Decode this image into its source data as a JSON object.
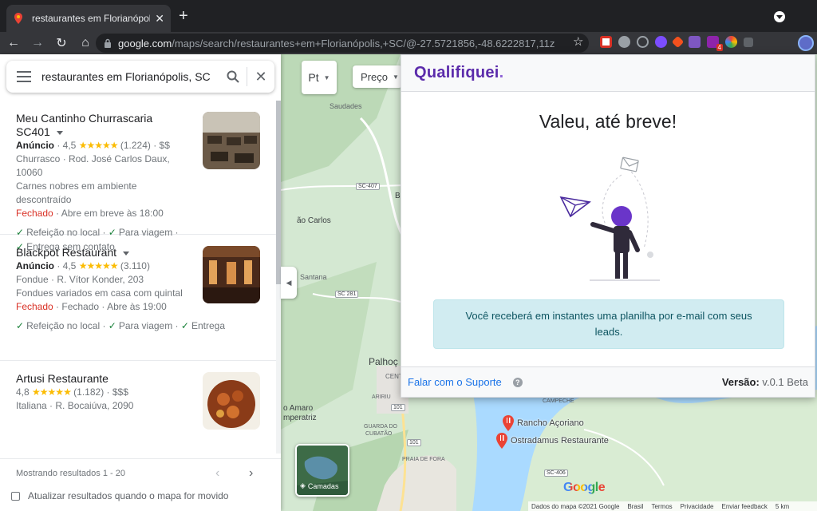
{
  "browser": {
    "tab_title": "restaurantes em Florianópolis, SC",
    "url_host": "google.com",
    "url_path": "/maps/search/restaurantes+em+Florianópolis,+SC/@-27.5721856,-48.6222817,11z",
    "ext_badge": "4"
  },
  "search": {
    "query": "restaurantes em Florianópolis, SC"
  },
  "results": [
    {
      "name": "Meu Cantinho Churrascaria SC401",
      "ad": "Anúncio",
      "rating": "4,5",
      "stars": "★★★★★",
      "reviews": "(1.224)",
      "price": "· $$",
      "address": "Churrasco · Rod. José Carlos Daux, 10060",
      "description": "Carnes nobres em ambiente descontraído",
      "status": "Fechado",
      "hours": "· Abre em breve às 18:00",
      "services": [
        "Refeição no local ·",
        "Para viagem ·",
        "Entrega sem contato"
      ]
    },
    {
      "name": "Blackpot Restaurant",
      "ad": "Anúncio",
      "rating": "4,5",
      "stars": "★★★★★",
      "reviews": "(3.110)",
      "address": "Fondue · R. Vítor Konder, 203",
      "description": "Fondues variados em casa com quintal",
      "status": "Fechado",
      "hours": "· Fechado · Abre às 19:00",
      "services": [
        "Refeição no local ·",
        "Para viagem ·",
        "Entrega"
      ]
    },
    {
      "name": "Artusi Restaurante",
      "rating": "4,8",
      "stars": "★★★★★",
      "reviews": "(1.182)",
      "price": "· $$$",
      "address": "Italiana · R. Bocaiúva, 2090"
    }
  ],
  "pager": {
    "text": "Mostrando resultados 1 - 20",
    "prev": "‹",
    "next": "›"
  },
  "auto_update": "Atualizar resultados quando o mapa for movido",
  "map": {
    "chip_short": "Pt",
    "chip_price": "Preço",
    "labels": {
      "saudades": "Saudades",
      "sc407": "SC-407",
      "sao_carlos": "ão Carlos",
      "santana": "Santana",
      "sc281": "SC 281",
      "palhoca": "Palhoç",
      "centro": "CENT",
      "ariri": "ARIRIU",
      "br101a": "101",
      "br101b": "101",
      "santo_amaro": "o Amaro",
      "imperatriz": "mperatriz",
      "guarda": "GUARDA DO",
      "cubatao": "CUBATÃO",
      "praia": "PRAIA DE FORA",
      "campeche": "CAMPECHE",
      "sc406": "SC-406",
      "bi": "Bi"
    },
    "pins": [
      "Rancho Açoriano",
      "Ostradamus Restaurante"
    ],
    "layers_label": "Camadas",
    "google_logo": "Google",
    "attribution": [
      "Dados do mapa ©2021 Google",
      "Brasil",
      "Termos",
      "Privacidade",
      "Enviar feedback",
      "5 km"
    ]
  },
  "popup": {
    "brand": "Qualifiquei",
    "brand_dot": ".",
    "heading": "Valeu, até breve!",
    "info": "Você receberá em instantes uma planilha por e-mail com seus leads.",
    "support_link": "Falar com o Suporte",
    "help": "?",
    "version_label": "Versão:",
    "version_value": " v.0.1 Beta",
    "brand_color": "#5b2bab"
  }
}
